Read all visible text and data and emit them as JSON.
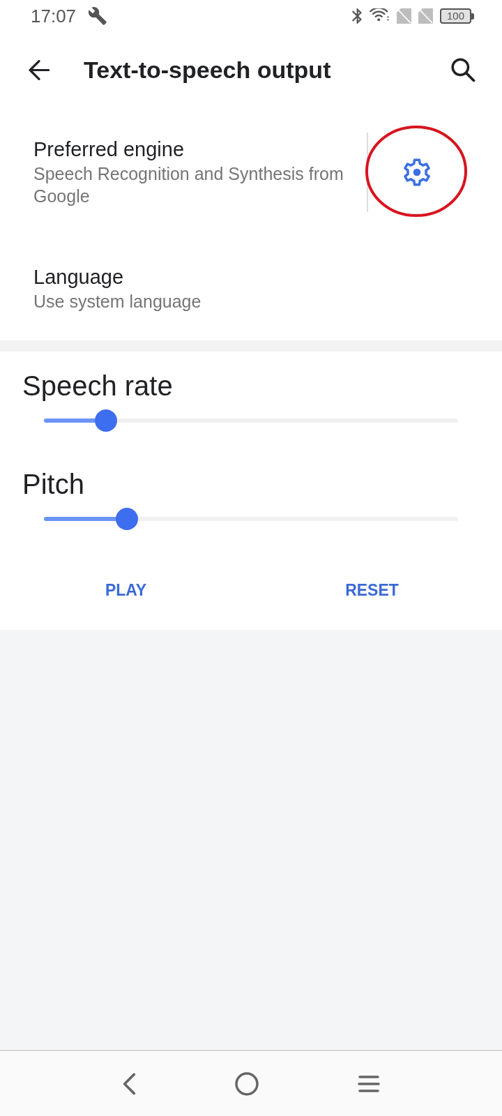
{
  "status_bar": {
    "time": "17:07",
    "battery": "100"
  },
  "app_bar": {
    "title": "Text-to-speech output"
  },
  "settings": [
    {
      "kind": "engine",
      "title": "Preferred engine",
      "subtitle": "Speech Recognition and Synthesis from Google",
      "highlighted": true
    },
    {
      "kind": "plain",
      "title": "Language",
      "subtitle": "Use system language",
      "highlighted": false
    }
  ],
  "sliders": [
    {
      "label": "Speech rate",
      "level": 0.15
    },
    {
      "label": "Pitch",
      "level": 0.2
    }
  ],
  "buttons": [
    "PLAY",
    "RESET"
  ]
}
